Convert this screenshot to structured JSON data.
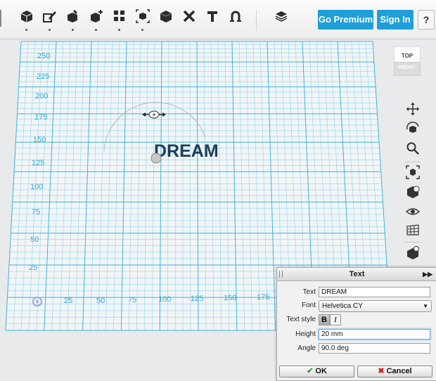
{
  "toolbar": {
    "tools": [
      {
        "icon": "cube-add-icon"
      },
      {
        "icon": "edit-icon"
      },
      {
        "icon": "modify-icon"
      },
      {
        "icon": "construct-icon"
      },
      {
        "icon": "pattern-icon"
      },
      {
        "icon": "group-icon"
      },
      {
        "icon": "solid-icon"
      },
      {
        "icon": "combine-icon"
      },
      {
        "icon": "text-icon"
      },
      {
        "icon": "snap-icon"
      },
      {
        "icon": "materials-icon"
      }
    ],
    "go_premium": "Go Premium",
    "sign_in": "Sign In",
    "help": "?"
  },
  "viewcube": {
    "top": "TOP",
    "front": "FRONT"
  },
  "grid": {
    "y_labels": [
      "250",
      "225",
      "200",
      "175",
      "150",
      "125",
      "100",
      "75",
      "50",
      "25"
    ],
    "x_labels": [
      "25",
      "50",
      "75",
      "100",
      "125",
      "150",
      "175"
    ],
    "grid_color": "#3fb4d8"
  },
  "scene": {
    "text_object": "DREAM",
    "text_color": "#1a3e5c"
  },
  "navbar": {
    "buttons": [
      {
        "icon": "pan-icon"
      },
      {
        "icon": "orbit-icon"
      },
      {
        "icon": "zoom-icon"
      },
      {
        "icon": "fit-all-icon"
      },
      {
        "icon": "solid-view-icon"
      },
      {
        "icon": "visibility-icon"
      },
      {
        "icon": "grid-icon"
      },
      {
        "icon": "materials-view-icon"
      }
    ]
  },
  "text_panel": {
    "title": "Text",
    "text_label": "Text",
    "text_value": "DREAM",
    "font_label": "Font",
    "font_value": "Helvetica CY",
    "style_label": "Text style",
    "bold": "B",
    "italic": "I",
    "height_label": "Height",
    "height_value": "20 mm",
    "angle_label": "Angle",
    "angle_value": "90.0 deg",
    "ok": "OK",
    "cancel": "Cancel"
  }
}
